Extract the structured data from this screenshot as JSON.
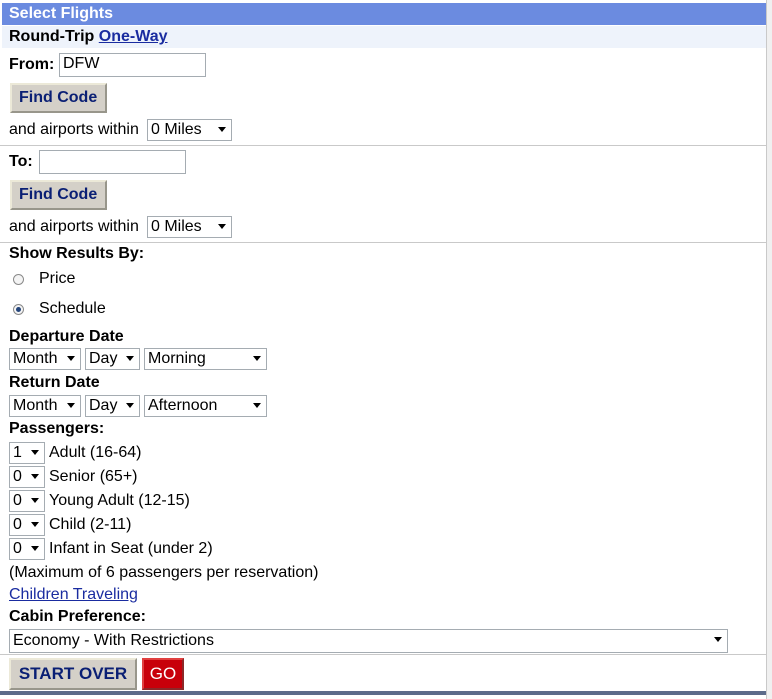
{
  "header": {
    "title": "Select Flights"
  },
  "trip": {
    "round_trip": "Round-Trip",
    "one_way": "One-Way"
  },
  "from": {
    "label": "From:",
    "value": "DFW",
    "find_code": "Find Code",
    "within_label": "and airports within",
    "within_value": "0 Miles"
  },
  "to": {
    "label": "To:",
    "value": "",
    "find_code": "Find Code",
    "within_label": "and airports within",
    "within_value": "0 Miles"
  },
  "results": {
    "label": "Show Results By:",
    "options": [
      "Price",
      "Schedule"
    ],
    "selected": "Schedule"
  },
  "departure": {
    "label": "Departure Date",
    "month": "Month",
    "day": "Day",
    "time": "Morning"
  },
  "return": {
    "label": "Return Date",
    "month": "Month",
    "day": "Day",
    "time": "Afternoon"
  },
  "passengers": {
    "label": "Passengers:",
    "rows": [
      {
        "count": "1",
        "label": "Adult (16-64)"
      },
      {
        "count": "0",
        "label": "Senior (65+)"
      },
      {
        "count": "0",
        "label": "Young Adult (12-15)"
      },
      {
        "count": "0",
        "label": "Child (2-11)"
      },
      {
        "count": "0",
        "label": "Infant in Seat (under 2)"
      }
    ],
    "note": "(Maximum of 6 passengers per reservation)",
    "children_link": "Children Traveling"
  },
  "cabin": {
    "label": "Cabin Preference:",
    "value": "Economy - With Restrictions"
  },
  "actions": {
    "start_over": "START OVER",
    "go": "GO"
  }
}
